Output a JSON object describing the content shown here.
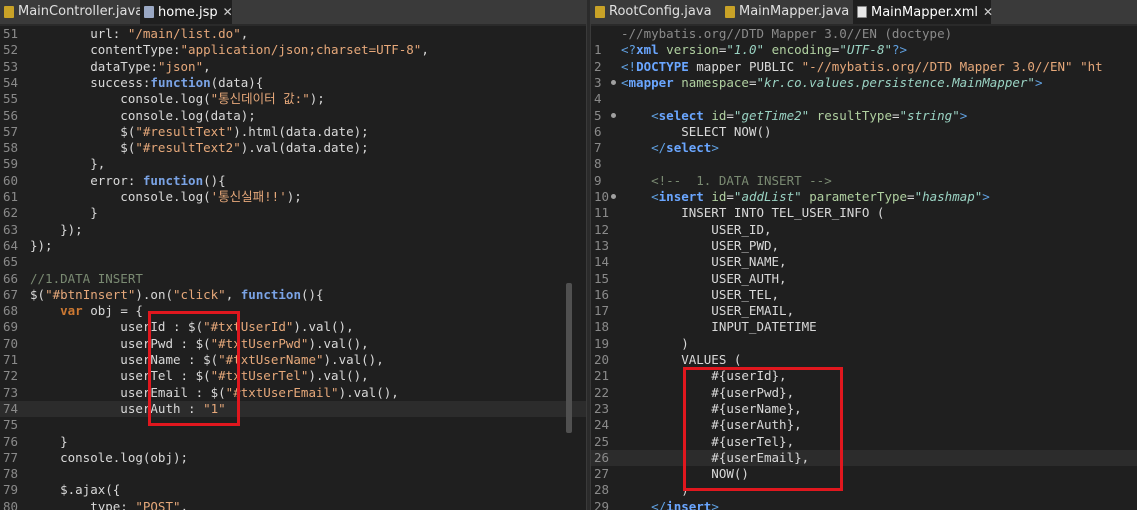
{
  "left": {
    "tabs": [
      {
        "label": "MainController.java",
        "icon": "java-file-icon",
        "active": false
      },
      {
        "label": "home.jsp",
        "icon": "jsp-file-icon",
        "active": true,
        "closable": true
      }
    ],
    "lines": [
      {
        "n": "51",
        "html": "        url: <span class='s'>\"/main/list.do\"</span>,"
      },
      {
        "n": "52",
        "html": "        contentType:<span class='s'>\"application/json;charset=UTF-8\"</span>,"
      },
      {
        "n": "53",
        "html": "        dataType:<span class='s'>\"json\"</span>,"
      },
      {
        "n": "54",
        "html": "        success:<span class='kb'>function</span>(data){"
      },
      {
        "n": "55",
        "html": "            console.log(<span class='s'>\"통신데이터 값:\"</span>);"
      },
      {
        "n": "56",
        "html": "            console.log(data);"
      },
      {
        "n": "57",
        "html": "            $(<span class='s'>\"#resultText\"</span>).html(data.date);"
      },
      {
        "n": "58",
        "html": "            $(<span class='s'>\"#resultText2\"</span>).val(data.date);"
      },
      {
        "n": "59",
        "html": "        },"
      },
      {
        "n": "60",
        "html": "        error: <span class='kb'>function</span>(){"
      },
      {
        "n": "61",
        "html": "            console.log(<span class='s'>'통신실패!!'</span>);"
      },
      {
        "n": "62",
        "html": "        }"
      },
      {
        "n": "63",
        "html": "    });"
      },
      {
        "n": "64",
        "html": "});"
      },
      {
        "n": "65",
        "html": ""
      },
      {
        "n": "66",
        "html": "<span class='c'>//1.DATA INSERT</span>"
      },
      {
        "n": "67",
        "html": "$(<span class='s'>\"#btnInsert\"</span>).on(<span class='s'>\"click\"</span>, <span class='kb'>function</span>(){"
      },
      {
        "n": "68",
        "html": "    <span class='k'>var</span> obj = {"
      },
      {
        "n": "69",
        "html": "            userId : $(<span class='s'>\"#txtUserId\"</span>).val(),"
      },
      {
        "n": "70",
        "html": "            userPwd : $(<span class='s'>\"#txtUserPwd\"</span>).val(),"
      },
      {
        "n": "71",
        "html": "            userName : $(<span class='s'>\"#txtUserName\"</span>).val(),"
      },
      {
        "n": "72",
        "html": "            userTel : $(<span class='s'>\"#txtUserTel\"</span>).val(),"
      },
      {
        "n": "73",
        "html": "            userEmail : $(<span class='s'>\"#txtUserEmail\"</span>).val(),"
      },
      {
        "n": "74",
        "html": "            userAuth : <span class='s'>\"1\"</span>",
        "current": true
      },
      {
        "n": "75",
        "html": ""
      },
      {
        "n": "76",
        "html": "    }"
      },
      {
        "n": "77",
        "html": "    console.log(obj);"
      },
      {
        "n": "78",
        "html": ""
      },
      {
        "n": "79",
        "html": "    $.ajax({"
      },
      {
        "n": "80",
        "html": "        type: <span class='s'>\"POST\"</span>,"
      }
    ]
  },
  "right": {
    "tabs": [
      {
        "label": "RootConfig.java",
        "icon": "java-file-icon",
        "active": false
      },
      {
        "label": "MainMapper.java",
        "icon": "java-file-icon",
        "active": false
      },
      {
        "label": "MainMapper.xml",
        "icon": "xml-file-icon",
        "active": true,
        "closable": true
      }
    ],
    "lines": [
      {
        "n": "",
        "html": "<span class='g'>-//mybatis.org//DTD Mapper 3.0//EN (doctype)</span>"
      },
      {
        "n": "1",
        "html": "<span class='t'>&lt;?</span><span class='tb'>xml</span> <span class='a'>version</span>=<span class='av'>\"1.0\"</span> <span class='a'>encoding</span>=<span class='av'>\"UTF-8\"</span><span class='t'>?&gt;</span>"
      },
      {
        "n": "2",
        "html": "<span class='t'>&lt;!</span><span class='tb'>DOCTYPE</span> mapper PUBLIC <span class='s'>\"-//mybatis.org//DTD Mapper 3.0//EN\"</span> <span class='s'>\"ht</span>"
      },
      {
        "n": "3",
        "bp": true,
        "html": "<span class='t'>&lt;</span><span class='tb'>mapper</span> <span class='a'>namespace</span>=<span class='av'>\"kr.co.values.persistence.MainMapper\"</span><span class='t'>&gt;</span>"
      },
      {
        "n": "4",
        "html": ""
      },
      {
        "n": "5",
        "bp": true,
        "html": "    <span class='t'>&lt;</span><span class='tb'>select</span> <span class='a'>id</span>=<span class='av'>\"getTime2\"</span> <span class='a'>resultType</span>=<span class='av'>\"string\"</span><span class='t'>&gt;</span>"
      },
      {
        "n": "6",
        "html": "        SELECT NOW()"
      },
      {
        "n": "7",
        "html": "    <span class='t'>&lt;/</span><span class='tb'>select</span><span class='t'>&gt;</span>"
      },
      {
        "n": "8",
        "html": ""
      },
      {
        "n": "9",
        "html": "    <span class='c'>&lt;!--  1. DATA INSERT --&gt;</span>"
      },
      {
        "n": "10",
        "bp": true,
        "html": "    <span class='t'>&lt;</span><span class='tb'>insert</span> <span class='a'>id</span>=<span class='av'>\"addList\"</span> <span class='a'>parameterType</span>=<span class='av'>\"hashmap\"</span><span class='t'>&gt;</span>"
      },
      {
        "n": "11",
        "html": "        INSERT INTO TEL_USER_INFO ("
      },
      {
        "n": "12",
        "html": "            USER_ID,"
      },
      {
        "n": "13",
        "html": "            USER_PWD,"
      },
      {
        "n": "14",
        "html": "            USER_NAME,"
      },
      {
        "n": "15",
        "html": "            USER_AUTH,"
      },
      {
        "n": "16",
        "html": "            USER_TEL,"
      },
      {
        "n": "17",
        "html": "            USER_EMAIL,"
      },
      {
        "n": "18",
        "html": "            INPUT_DATETIME"
      },
      {
        "n": "19",
        "html": "        )"
      },
      {
        "n": "20",
        "html": "        VALUES ("
      },
      {
        "n": "21",
        "html": "            #{userId},"
      },
      {
        "n": "22",
        "html": "            #{userPwd},"
      },
      {
        "n": "23",
        "html": "            #{userName},"
      },
      {
        "n": "24",
        "html": "            #{userAuth},"
      },
      {
        "n": "25",
        "html": "            #{userTel},"
      },
      {
        "n": "26",
        "html": "            #{userEmail},",
        "current": true
      },
      {
        "n": "27",
        "html": "            NOW()"
      },
      {
        "n": "28",
        "html": "        )"
      },
      {
        "n": "29",
        "html": "    <span class='t'>&lt;/</span><span class='tb'>insert</span><span class='t'>&gt;</span>"
      }
    ]
  },
  "colors": {
    "highlight_box": "#e0171e",
    "editor_bg": "#1f1f1f"
  }
}
